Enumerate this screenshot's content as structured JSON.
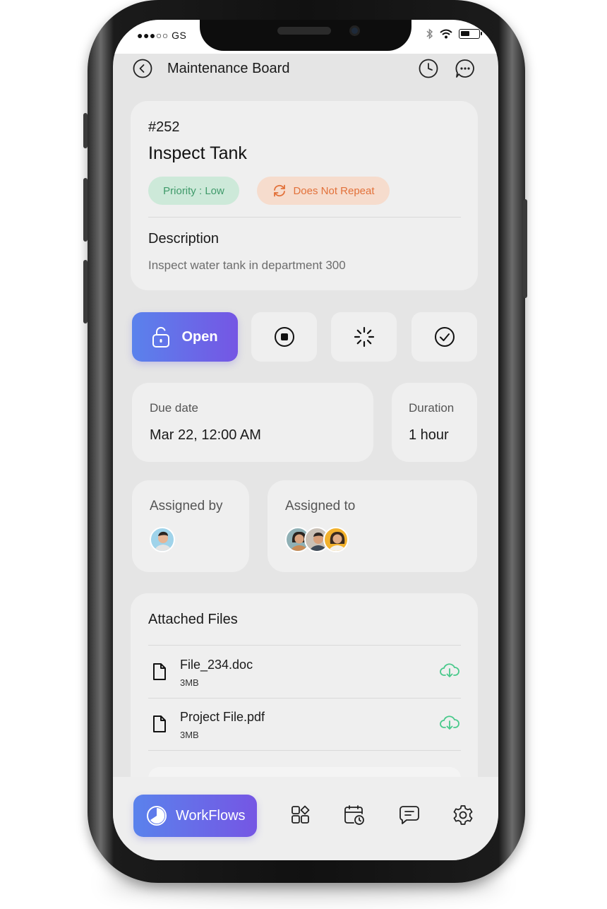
{
  "status_bar": {
    "carrier": "●●●○○ GS"
  },
  "header": {
    "title": "Maintenance Board",
    "back_icon": "chevron-left-icon",
    "history_icon": "clock-icon",
    "chat_icon": "chat-bubble-icon"
  },
  "task": {
    "number": "#252",
    "title": "Inspect Tank",
    "priority_label": "Priority : Low",
    "repeat_label": "Does Not Repeat",
    "description_heading": "Description",
    "description_text": "Inspect water tank in department 300",
    "colors": {
      "priority_bg": "#cde9d9",
      "priority_text": "#3f9a6a",
      "repeat_bg": "#f6dccd",
      "repeat_text": "#e2713a"
    }
  },
  "status_actions": {
    "open_label": "Open",
    "options": [
      {
        "name": "open",
        "icon": "lock-open-icon",
        "active": true
      },
      {
        "name": "on-hold",
        "icon": "stop-circle-icon",
        "active": false
      },
      {
        "name": "in-progress",
        "icon": "loading-spinner-icon",
        "active": false
      },
      {
        "name": "done",
        "icon": "check-circle-icon",
        "active": false
      }
    ],
    "accent_gradient": [
      "#5a82ec",
      "#7556e4"
    ]
  },
  "schedule": {
    "due_label": "Due date",
    "due_value": "Mar 22, 12:00 AM",
    "duration_label": "Duration",
    "duration_value": "1 hour"
  },
  "assignment": {
    "assigned_by_label": "Assigned by",
    "assigned_to_label": "Assigned to",
    "assigned_by_count": 1,
    "assigned_to_count": 3
  },
  "files": {
    "heading": "Attached Files",
    "items": [
      {
        "name": "File_234.doc",
        "size": "3MB"
      },
      {
        "name": "Project File.pdf",
        "size": "3MB"
      }
    ],
    "download_color": "#49c98b"
  },
  "bottom_nav": {
    "primary_label": "WorkFlows",
    "items": [
      "workflows-icon",
      "apps-grid-icon",
      "calendar-clock-icon",
      "message-icon",
      "settings-gear-icon"
    ]
  }
}
